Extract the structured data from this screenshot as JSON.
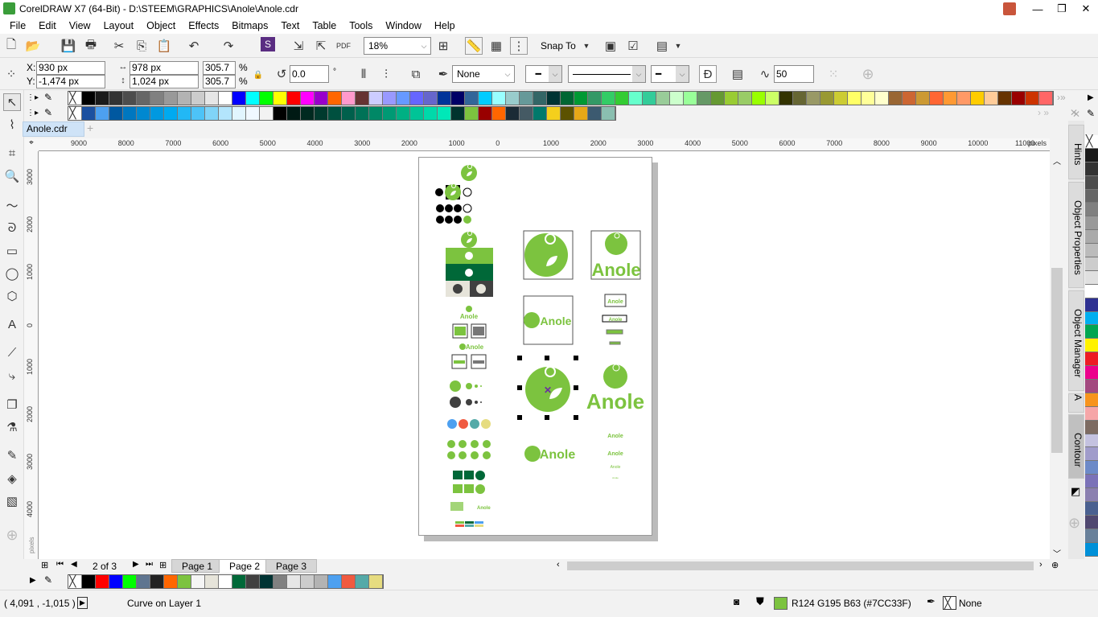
{
  "window": {
    "title": "CorelDRAW X7 (64-Bit) - D:\\STEEM\\GRAPHICS\\Anole\\Anole.cdr",
    "minimize": "—",
    "restore": "❐",
    "close": "✕"
  },
  "menu": [
    "File",
    "Edit",
    "View",
    "Layout",
    "Object",
    "Effects",
    "Bitmaps",
    "Text",
    "Table",
    "Tools",
    "Window",
    "Help"
  ],
  "toolbar": {
    "zoom": "18%",
    "snap_to": "Snap To"
  },
  "property_bar": {
    "x_label": "X:",
    "x": "930 px",
    "y_label": "Y:",
    "y": "-1,474 px",
    "width": "978 px",
    "height": "1,024 px",
    "scale_x": "305.7",
    "scale_y": "305.7",
    "pct": "%",
    "rotation": "0.0",
    "degree": "°",
    "outline": "None",
    "contour_value": "50"
  },
  "palette_row1": [
    "#000000",
    "#1a1a1a",
    "#333333",
    "#4d4d4d",
    "#666666",
    "#808080",
    "#999999",
    "#b3b3b3",
    "#cccccc",
    "#e6e6e6",
    "#ffffff",
    "#0000ff",
    "#00ffff",
    "#00ff00",
    "#ffff00",
    "#ff0000",
    "#ff00ff",
    "#9900cc",
    "#ff6600",
    "#ff99cc",
    "#663333",
    "#ccccff",
    "#9999ff",
    "#6699ff",
    "#6666ff",
    "#6666cc",
    "#003399",
    "#000066",
    "#336699",
    "#00ccff",
    "#99ffff",
    "#99cccc",
    "#669999",
    "#336666",
    "#003333",
    "#006633",
    "#009933",
    "#339966",
    "#33cc66",
    "#33cc33",
    "#66ffcc",
    "#33cc99",
    "#99cc99",
    "#ccffcc",
    "#99ff99",
    "#669966",
    "#669933",
    "#99cc33",
    "#99cc66",
    "#99ff00",
    "#ccff66",
    "#333300",
    "#666633",
    "#999966",
    "#999933",
    "#cccc33",
    "#ffff66",
    "#ffff99",
    "#ffffcc",
    "#996633",
    "#cc6633",
    "#cc9933",
    "#ff6633",
    "#ff9933",
    "#ff9966",
    "#ffcc00",
    "#ffcc99",
    "#663300",
    "#990000",
    "#cc3300",
    "#ff6666"
  ],
  "palette_row2": [
    "#1c50a0",
    "#4da0f0",
    "#0058a0",
    "#0077c0",
    "#0088d0",
    "#0099e0",
    "#00aaf0",
    "#22b8f5",
    "#4dc3f7",
    "#80d4f8",
    "#b3e5fc",
    "#e1f5fe",
    "#f0f8ff",
    "#f2f2f2",
    "#000000",
    "#001a14",
    "#002a20",
    "#003a2e",
    "#00503f",
    "#00604c",
    "#007257",
    "#008866",
    "#009a74",
    "#00b083",
    "#00c497",
    "#00d9aa",
    "#00e8b8",
    "#00332e",
    "#7cc33f",
    "#990000",
    "#ff6600",
    "#1b2b36",
    "#455a64",
    "#00796b",
    "#f4cf1c",
    "#5c5200",
    "#e6a817",
    "#3c5a70",
    "#8abfb0"
  ],
  "palette_right": [
    "#1a1a1a",
    "#333333",
    "#4d4d4d",
    "#666666",
    "#808080",
    "#999999",
    "#aaaaaa",
    "#bbbbbb",
    "#cccccc",
    "#e0e0e0",
    "#ffffff",
    "#2e3192",
    "#00aeef",
    "#00a651",
    "#fff200",
    "#ed1c24",
    "#ec008c",
    "#a3487f",
    "#f7941d",
    "#f6a6a8",
    "#7d6b62",
    "#c4c2e0",
    "#a09ccb",
    "#6c8ac8",
    "#7b72b8",
    "#8b80b0",
    "#4a6090",
    "#504870",
    "#68809a",
    "#0090d8"
  ],
  "palette_bottom": [
    "#000000",
    "#ff0000",
    "#0000ff",
    "#00ff00",
    "#5f7590",
    "#222222",
    "#ff6600",
    "#7cc33f",
    "#f5f5f5",
    "#e6e4da",
    "#ffffff",
    "#006838",
    "#404040",
    "#003333",
    "#808080",
    "#e6e6e6",
    "#cccccc",
    "#b3b3b3",
    "#4da0f0",
    "#f05a40",
    "#55aaa8",
    "#e6dc80"
  ],
  "document": {
    "tab": "Anole.cdr"
  },
  "ruler": {
    "h_labels": [
      "9000",
      "8000",
      "7000",
      "6000",
      "5000",
      "4000",
      "3000",
      "2000",
      "1000",
      "0",
      "1000",
      "2000",
      "3000",
      "4000",
      "5000",
      "6000",
      "7000",
      "8000",
      "9000",
      "10000",
      "11000"
    ],
    "unit": "pixels",
    "v_labels": [
      "3000",
      "2000",
      "1000",
      "0",
      "1000",
      "2000",
      "3000",
      "4000"
    ],
    "v_unit": "pixels"
  },
  "dockers": [
    "Hints",
    "Object Properties",
    "Object Manager",
    "Contour"
  ],
  "artwork": {
    "logo_text": "Anole",
    "brand_green": "#7cc33f",
    "dark_green": "#006838"
  },
  "pages": {
    "counter": "2 of 3",
    "tabs": [
      "Page 1",
      "Page 2",
      "Page 3"
    ],
    "active": "Page 2"
  },
  "status": {
    "coords": "( 4,091 , -1,015 )",
    "object": "Curve on Layer 1",
    "fill": "R124 G195 B63 (#7CC33F)",
    "fill_color": "#7cc33f",
    "outline": "None"
  }
}
